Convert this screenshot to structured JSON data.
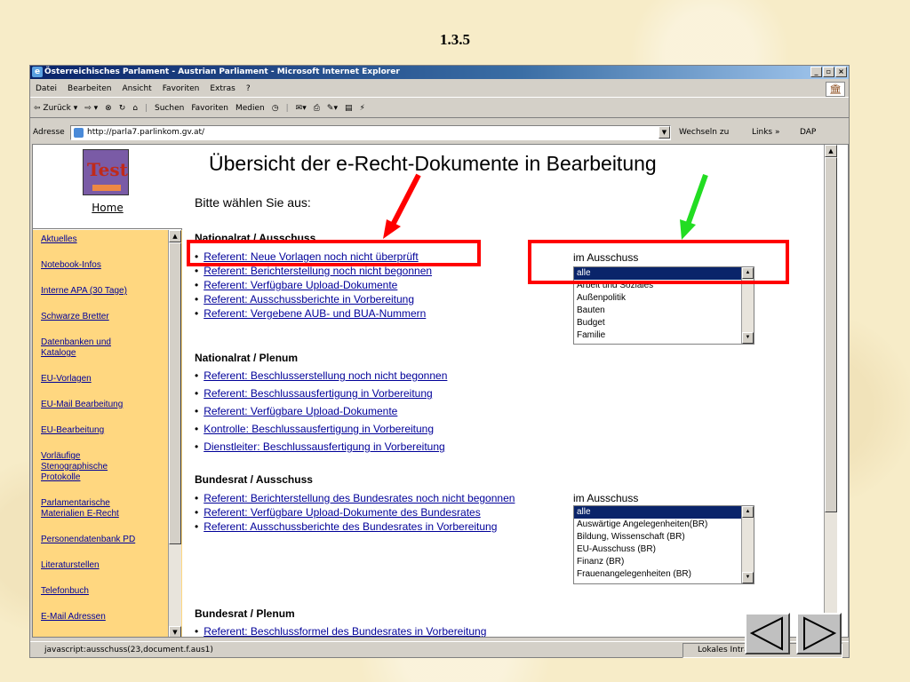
{
  "slide_number": "1.3.5",
  "window": {
    "title": "Österreichisches Parlament - Austrian Parliament - Microsoft Internet Explorer",
    "buttons": [
      "_",
      "▫",
      "×"
    ]
  },
  "menubar": [
    "Datei",
    "Bearbeiten",
    "Ansicht",
    "Favoriten",
    "Extras",
    "?"
  ],
  "toolbar": {
    "back": "⇦ Zurück ▾",
    "forward": "⇨ ▾",
    "stop": "⊗",
    "refresh": "↻",
    "home": "⌂",
    "search": "Suchen",
    "favorites": "Favoriten",
    "media": "Medien",
    "history": "◷",
    "mail": "✉▾",
    "print": "⎙",
    "edit": "✎▾",
    "discuss": "▤",
    "messenger": "⚡"
  },
  "addressbar": {
    "label": "Adresse",
    "url": "http://parla7.parlinkom.gv.at/",
    "go": "Wechseln zu",
    "links": "Links »",
    "dap": "DAP"
  },
  "sidebar": {
    "logo_text": "Test",
    "home_label": "Home",
    "items": [
      "Aktuelles",
      "Notebook-Infos",
      "Interne APA (30 Tage)",
      "Schwarze Bretter",
      "Datenbanken und Kataloge",
      "EU-Vorlagen",
      "EU-Mail Bearbeitung",
      "EU-Bearbeitung",
      "Vorläufige Stenographische Protokolle",
      "Parlamentarische Materialien E-Recht",
      "Personendatenbank PD",
      "Literaturstellen",
      "Telefonbuch",
      "E-Mail Adressen"
    ]
  },
  "main": {
    "title": "Übersicht der e-Recht-Dokumente in Bearbeitung",
    "choose": "Bitte wählen Sie aus:",
    "sections": [
      {
        "title": "Nationalrat / Ausschuss",
        "links": [
          "Referent: Neue Vorlagen noch nicht überprüft",
          "Referent: Berichterstellung noch nicht begonnen",
          "Referent: Verfügbare Upload-Dokumente",
          "Referent: Ausschussberichte in Vorbereitung",
          "Referent: Vergebene AUB- und BUA-Nummern"
        ],
        "select_label": "im Ausschuss",
        "options": [
          "alle",
          "Arbeit und Soziales",
          "Außenpolitik",
          "Bauten",
          "Budget",
          "Familie"
        ]
      },
      {
        "title": "Nationalrat / Plenum",
        "links": [
          "Referent: Beschlusserstellung noch nicht begonnen",
          "Referent: Beschlussausfertigung in Vorbereitung",
          "Referent: Verfügbare Upload-Dokumente",
          "Kontrolle: Beschlussausfertigung in Vorbereitung",
          "Dienstleiter: Beschlussausfertigung in Vorbereitung"
        ]
      },
      {
        "title": "Bundesrat / Ausschuss",
        "links": [
          "Referent: Berichterstellung des Bundesrates noch nicht begonnen",
          "Referent: Verfügbare Upload-Dokumente des Bundesrates",
          "Referent: Ausschussberichte des Bundesrates in Vorbereitung"
        ],
        "select_label": "im Ausschuss",
        "options": [
          "alle",
          "Auswärtige Angelegenheiten(BR)",
          "Bildung, Wissenschaft (BR)",
          "EU-Ausschuss (BR)",
          "Finanz (BR)",
          "Frauenangelegenheiten (BR)"
        ]
      },
      {
        "title": "Bundesrat / Plenum",
        "links": [
          "Referent: Beschlussformel des Bundesrates in Vorbereitung"
        ]
      }
    ]
  },
  "statusbar": {
    "text": "javascript:ausschuss(23,document.f.aus1)",
    "zone": "Lokales Intranet"
  },
  "colors": {
    "highlight": "#ff0000",
    "red_arrow": "#ff0000",
    "green_arrow": "#22dd22",
    "link": "#000099",
    "sidebar_bg": "#ffd780"
  }
}
